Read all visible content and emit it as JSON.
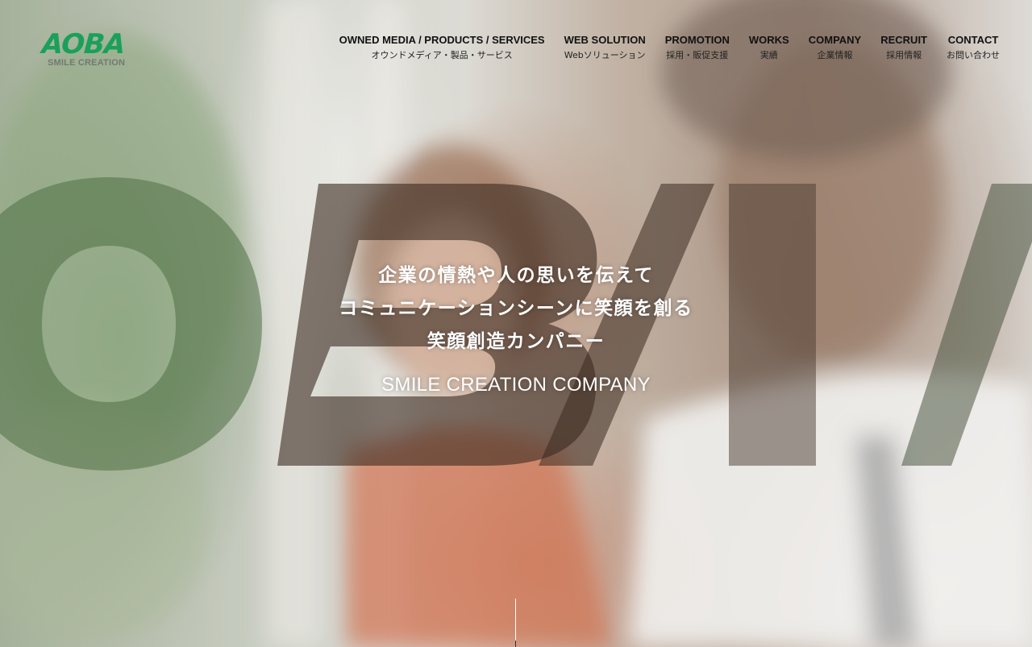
{
  "brand": {
    "logo_text": "AOBA",
    "logo_sub": "SMILE CREATION",
    "accent_color": "#1aa05a"
  },
  "nav": {
    "items": [
      {
        "en": "OWNED MEDIA / PRODUCTS / SERVICES",
        "ja": "オウンドメディア・製品・サービス"
      },
      {
        "en": "WEB SOLUTION",
        "ja": "Webソリューション"
      },
      {
        "en": "PROMOTION",
        "ja": "採用・販促支援"
      },
      {
        "en": "WORKS",
        "ja": "実績"
      },
      {
        "en": "COMPANY",
        "ja": "企業情報"
      },
      {
        "en": "RECRUIT",
        "ja": "採用情報"
      },
      {
        "en": "CONTACT",
        "ja": "お問い合わせ"
      }
    ]
  },
  "hero": {
    "background_letters": "OBA",
    "line1": "企業の情熱や人の思いを伝えて",
    "line2": "コミュニケーションシーンに笑顔を創る",
    "line3": "笑顔創造カンパニー",
    "tagline": "SMILE CREATION COMPANY"
  }
}
